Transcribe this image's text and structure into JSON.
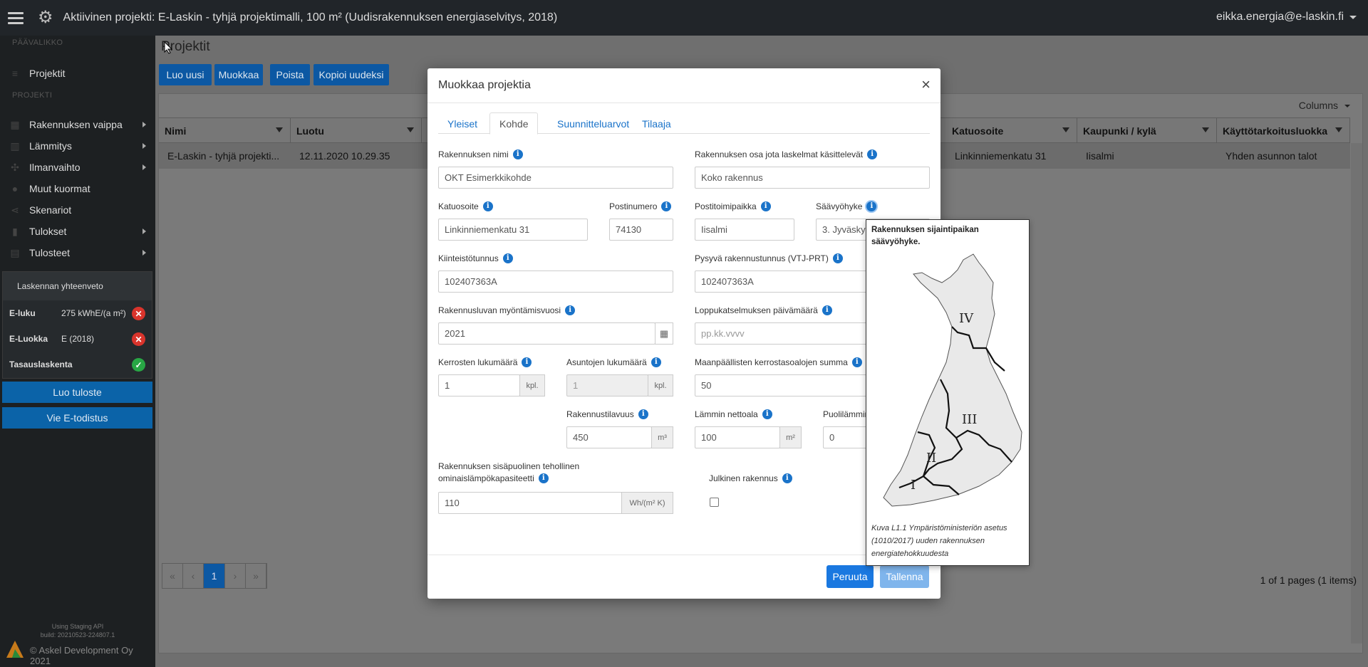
{
  "topbar": {
    "title": "Aktiivinen projekti: E-Laskin - tyhjä projektimalli, 100 m² (Uudisrakennuksen energiaselvitys, 2018)",
    "user": "eikka.energia@e-laskin.fi"
  },
  "sidebar": {
    "section_main": "PÄÄVALIKKO",
    "section_project": "PROJEKTI",
    "projects": "Projektit",
    "items": [
      {
        "label": "Rakennuksen vaippa"
      },
      {
        "label": "Lämmitys"
      },
      {
        "label": "Ilmanvaihto"
      },
      {
        "label": "Muut kuormat"
      },
      {
        "label": "Skenariot"
      },
      {
        "label": "Tulokset"
      },
      {
        "label": "Tulosteet"
      }
    ],
    "summary": {
      "title": "Laskennan yhteenveto",
      "rows": [
        {
          "label": "E-luku",
          "value": "275 kWhE/(a m²)",
          "status": "error"
        },
        {
          "label": "E-Luokka",
          "value": "E (2018)",
          "status": "error"
        },
        {
          "label": "Tasauslaskenta",
          "value": "",
          "status": "ok"
        }
      ]
    },
    "btn_print": "Luo tuloste",
    "btn_export": "Vie E-todistus",
    "footer_api": "Using Staging API",
    "footer_build": "build: 20210523-224807.1",
    "copyright": "© Askel Development Oy 2021"
  },
  "main": {
    "title": "Projektit",
    "toolbar": {
      "new": "Luo uusi",
      "edit": "Muokkaa",
      "delete": "Poista",
      "copy": "Kopioi uudeksi"
    },
    "columns_button": "Columns",
    "headers": {
      "name": "Nimi",
      "created": "Luotu",
      "address": "Katuosoite",
      "city": "Kaupunki / kylä",
      "usage": "Käyttötarkoitusluokka"
    },
    "row": {
      "name": "E-Laskin - tyhjä projekti...",
      "created": "12.11.2020 10.29.35",
      "address": "Linkinniemenkatu 31",
      "city": "Iisalmi",
      "usage": "Yhden asunnon talot"
    },
    "pager": {
      "page": "1",
      "info": "1 of 1 pages (1 items)"
    }
  },
  "modal": {
    "title": "Muokkaa projektia",
    "close": "×",
    "tabs": {
      "general": "Yleiset",
      "target": "Kohde",
      "design": "Suunnitteluarvot",
      "client": "Tilaaja"
    },
    "fields": {
      "building_name": {
        "label": "Rakennuksen nimi",
        "value": "OKT Esimerkkikohde"
      },
      "building_part": {
        "label": "Rakennuksen osa jota laskelmat käsittelevät",
        "value": "Koko rakennus"
      },
      "street": {
        "label": "Katuosoite",
        "value": "Linkinniemenkatu 31"
      },
      "postal": {
        "label": "Postinumero",
        "value": "74130"
      },
      "city": {
        "label": "Postitoimipaikka",
        "value": "Iisalmi"
      },
      "zone": {
        "label": "Säävyöhyke",
        "value": "3. Jyväskylä"
      },
      "property_id": {
        "label": "Kiinteistötunnus",
        "value": "102407363A"
      },
      "building_id": {
        "label": "Pysyvä rakennustunnus (VTJ-PRT)",
        "value": "102407363A"
      },
      "permit_year": {
        "label": "Rakennusluvan myöntämisvuosi",
        "value": "2021"
      },
      "final_date": {
        "label": "Loppukatselmuksen päivämäärä",
        "placeholder": "pp.kk.vvvv"
      },
      "floors": {
        "label": "Kerrosten lukumäärä",
        "value": "1",
        "unit": "kpl."
      },
      "apartments": {
        "label": "Asuntojen lukumäärä",
        "value": "1",
        "unit": "kpl."
      },
      "floor_area_sum": {
        "label": "Maanpäällisten kerrostasoalojen summa",
        "value": "50"
      },
      "volume": {
        "label": "Rakennustilavuus",
        "value": "450",
        "unit": "m³"
      },
      "heated_area": {
        "label": "Lämmin nettoala",
        "value": "100",
        "unit": "m²"
      },
      "semi_heated": {
        "label": "Puolilämmin",
        "value": "0"
      },
      "heat_capacity": {
        "label_line1": "Rakennuksen sisäpuolinen tehollinen",
        "label_line2": "ominaislämpökapasiteetti",
        "value": "110",
        "unit": "Wh/(m² K)"
      },
      "public_building": {
        "label": "Julkinen rakennus",
        "checked": false
      }
    },
    "cancel": "Peruuta",
    "save": "Tallenna"
  },
  "tooltip": {
    "title": "Rakennuksen sijaintipaikan säävyöhyke.",
    "zones": [
      "I",
      "II",
      "III",
      "IV"
    ],
    "caption": "Kuva L1.1 Ympäristöministeriön asetus (1010/2017) uuden rakennuksen energiatehokkuudesta"
  },
  "colors": {
    "primary": "#1a78e0",
    "topbar": "#212529",
    "sidebar": "#1d2022",
    "error": "#d9342c",
    "ok": "#28a745"
  }
}
